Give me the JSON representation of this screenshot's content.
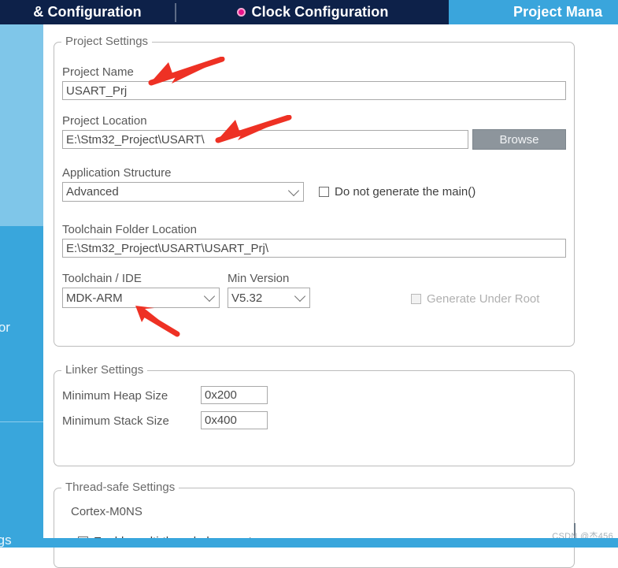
{
  "tabs": [
    {
      "label": "& Configuration",
      "name": "tab-pinout-configuration",
      "active": false,
      "has_warning": false
    },
    {
      "label": "Clock Configuration",
      "name": "tab-clock-configuration",
      "active": false,
      "has_warning": true
    },
    {
      "label": "Project Mana",
      "name": "tab-project-manager",
      "active": true,
      "has_warning": false
    }
  ],
  "sidebar": {
    "items": [
      {
        "label": "rator",
        "name": "sidebar-item-code-generator"
      },
      {
        "label": "ttings",
        "name": "sidebar-item-advanced-settings"
      }
    ]
  },
  "project_settings": {
    "legend": "Project Settings",
    "project_name_label": "Project Name",
    "project_name_value": "USART_Prj",
    "project_location_label": "Project Location",
    "project_location_value": "E:\\Stm32_Project\\USART\\",
    "browse_label": "Browse",
    "application_structure_label": "Application Structure",
    "application_structure_value": "Advanced",
    "do_not_generate_main_label": "Do not generate the main()",
    "do_not_generate_main_checked": false,
    "toolchain_folder_label": "Toolchain Folder Location",
    "toolchain_folder_value": "E:\\Stm32_Project\\USART\\USART_Prj\\",
    "toolchain_ide_label": "Toolchain / IDE",
    "toolchain_ide_value": "MDK-ARM",
    "min_version_label": "Min Version",
    "min_version_value": "V5.32",
    "generate_under_root_label": "Generate Under Root",
    "generate_under_root_checked": false,
    "generate_under_root_disabled": true
  },
  "linker_settings": {
    "legend": "Linker Settings",
    "min_heap_label": "Minimum Heap Size",
    "min_heap_value": "0x200",
    "min_stack_label": "Minimum Stack Size",
    "min_stack_value": "0x400"
  },
  "thread_safe_settings": {
    "legend": "Thread-safe Settings",
    "core_label": "Cortex-M0NS",
    "enable_multithread_label": "Enable multi-threaded support",
    "enable_multithread_checked": false
  },
  "watermark": {
    "text": "CSDN @杰456"
  },
  "colors": {
    "tabbar_bg": "#0d2149",
    "active_tab_bg": "#3aa5dc",
    "sidebar_light": "#7fc6e9",
    "sidebar_dark": "#39a6dc",
    "warning_dot": "#e8158b",
    "annotation_arrow": "#ee3124",
    "browse_button_bg": "#8d959c"
  }
}
